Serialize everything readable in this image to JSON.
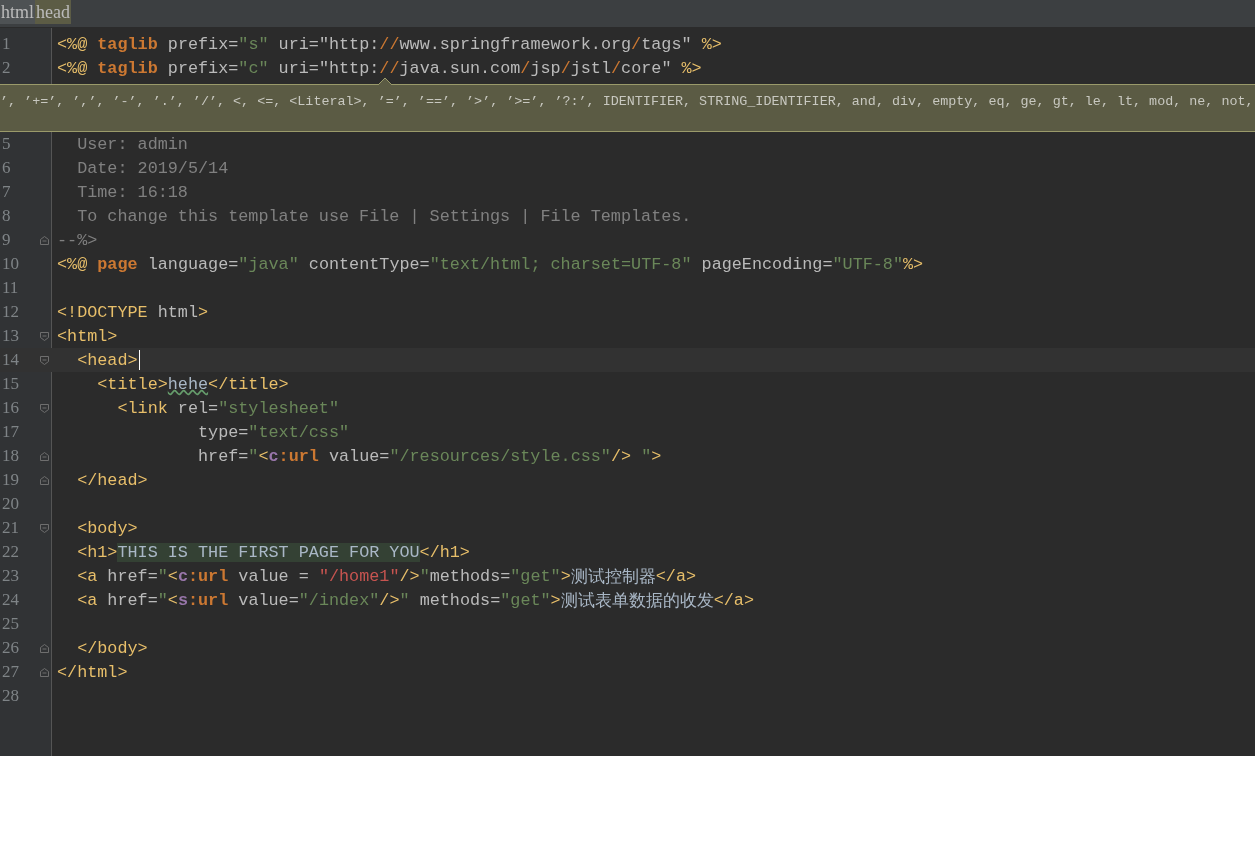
{
  "breadcrumb": [
    {
      "label": "html",
      "selected": false
    },
    {
      "label": "head",
      "selected": true
    }
  ],
  "lines": [
    {
      "number": "1",
      "current": false,
      "tokens": [
        {
          "kind": "tag",
          "text": "<%@ "
        },
        {
          "kind": "kw",
          "text": "taglib"
        },
        {
          "kind": "attr",
          "text": " prefix="
        },
        {
          "kind": "str",
          "text": "\"s\""
        },
        {
          "kind": "attr",
          "text": " uri="
        },
        {
          "kind": "val",
          "text": "\"http:"
        },
        {
          "kind": "slash",
          "text": "//"
        },
        {
          "kind": "val",
          "text": "www.springframework.org"
        },
        {
          "kind": "slash",
          "text": "/"
        },
        {
          "kind": "val",
          "text": "tags\" "
        },
        {
          "kind": "tag",
          "text": "%>"
        }
      ]
    },
    {
      "number": "2",
      "current": false,
      "tokens": [
        {
          "kind": "tag",
          "text": "<%@ "
        },
        {
          "kind": "kw",
          "text": "taglib"
        },
        {
          "kind": "attr",
          "text": " prefix="
        },
        {
          "kind": "str",
          "text": "\"c\""
        },
        {
          "kind": "attr",
          "text": " uri="
        },
        {
          "kind": "val",
          "text": "\"http:"
        },
        {
          "kind": "slash",
          "text": "//"
        },
        {
          "kind": "val",
          "text": "java.sun.com"
        },
        {
          "kind": "slash",
          "text": "/"
        },
        {
          "kind": "val",
          "text": "jsp"
        },
        {
          "kind": "slash",
          "text": "/"
        },
        {
          "kind": "val",
          "text": "jstl"
        },
        {
          "kind": "slash",
          "text": "/"
        },
        {
          "kind": "val",
          "text": "core\" "
        },
        {
          "kind": "tag",
          "text": "%>"
        }
      ]
    },
    {
      "kind": "tooltip",
      "text": "’, ’+=’, ’,’, ’-’, ’.’, ’/’, <, <=, <Literal>, ’=’, ’==’, ’>’, ’>=’, ’?:’, IDENTIFIER, STRING_IDENTIFIER, and, div, empty, eq, ge, gt, le, lt, mod, ne, not,"
    },
    {
      "number": "5",
      "current": false,
      "tokens": [
        {
          "kind": "comment",
          "text": "  User: admin"
        }
      ]
    },
    {
      "number": "6",
      "current": false,
      "tokens": [
        {
          "kind": "comment",
          "text": "  Date: 2019/5/14"
        }
      ]
    },
    {
      "number": "7",
      "current": false,
      "tokens": [
        {
          "kind": "comment",
          "text": "  Time: 16:18"
        }
      ]
    },
    {
      "number": "8",
      "current": false,
      "tokens": [
        {
          "kind": "comment",
          "text": "  To change this template use File | Settings | File Templates."
        }
      ]
    },
    {
      "number": "9",
      "current": false,
      "fold": {
        "kind": "end"
      },
      "tokens": [
        {
          "kind": "comment",
          "text": "--%>"
        }
      ]
    },
    {
      "number": "10",
      "current": false,
      "tokens": [
        {
          "kind": "tag",
          "text": "<%@ "
        },
        {
          "kind": "kw",
          "text": "page"
        },
        {
          "kind": "attr",
          "text": " language="
        },
        {
          "kind": "str",
          "text": "\"java\""
        },
        {
          "kind": "attr",
          "text": " contentType="
        },
        {
          "kind": "str",
          "text": "\"text/html; charset=UTF-8\""
        },
        {
          "kind": "attr",
          "text": " pageEncoding="
        },
        {
          "kind": "str",
          "text": "\"UTF-8\""
        },
        {
          "kind": "tag",
          "text": "%>"
        }
      ]
    },
    {
      "number": "11",
      "current": false
    },
    {
      "number": "12",
      "current": false,
      "tokens": [
        {
          "kind": "tag",
          "text": "<!DOCTYPE"
        },
        {
          "kind": "attr",
          "text": " html"
        },
        {
          "kind": "tag",
          "text": ">"
        }
      ]
    },
    {
      "number": "13",
      "current": false,
      "fold": {
        "kind": "start"
      },
      "tokens": [
        {
          "kind": "tag",
          "text": "<html>"
        }
      ]
    },
    {
      "number": "14",
      "current": true,
      "fold": {
        "kind": "start"
      },
      "tokens": [
        {
          "kind": "tag",
          "text": "  <head>"
        }
      ]
    },
    {
      "number": "15",
      "current": false,
      "tokens": [
        {
          "kind": "tag",
          "text": "    <title>"
        },
        {
          "kind": "typo",
          "text": "hehe"
        },
        {
          "kind": "tag",
          "text": "</title>"
        }
      ]
    },
    {
      "number": "16",
      "current": false,
      "fold": {
        "kind": "start"
      },
      "tokens": [
        {
          "kind": "tag",
          "text": "      <link"
        },
        {
          "kind": "attr",
          "text": " rel="
        },
        {
          "kind": "str",
          "text": "\"stylesheet\""
        }
      ]
    },
    {
      "number": "17",
      "current": false,
      "tokens": [
        {
          "kind": "attr",
          "text": "              type="
        },
        {
          "kind": "str",
          "text": "\"text/css\""
        }
      ]
    },
    {
      "number": "18",
      "current": false,
      "fold": {
        "kind": "end"
      },
      "tokens": [
        {
          "kind": "attr",
          "text": "              href="
        },
        {
          "kind": "str",
          "text": "\""
        },
        {
          "kind": "tag",
          "text": "<"
        },
        {
          "kind": "ns",
          "text": "c"
        },
        {
          "kind": "kw",
          "text": ":url"
        },
        {
          "kind": "attr",
          "text": " value="
        },
        {
          "kind": "str",
          "text": "\"/resources/style.css\""
        },
        {
          "kind": "tag",
          "text": "/>"
        },
        {
          "kind": "str",
          "text": " \""
        },
        {
          "kind": "tag",
          "text": ">"
        }
      ]
    },
    {
      "number": "19",
      "current": false,
      "fold": {
        "kind": "end"
      },
      "tokens": [
        {
          "kind": "tag",
          "text": "  </head>"
        }
      ]
    },
    {
      "number": "20",
      "current": false
    },
    {
      "number": "21",
      "current": false,
      "fold": {
        "kind": "start"
      },
      "tokens": [
        {
          "kind": "tag",
          "text": "  <body>"
        }
      ]
    },
    {
      "number": "22",
      "current": false,
      "tokens": [
        {
          "kind": "tag",
          "text": "  <h1>"
        },
        {
          "kind": "hl",
          "text": "THIS IS THE FIRST PAGE FOR YOU"
        },
        {
          "kind": "tag",
          "text": "</h1>"
        }
      ]
    },
    {
      "number": "23",
      "current": false,
      "tokens": [
        {
          "kind": "tag",
          "text": "  <a"
        },
        {
          "kind": "attr",
          "text": " href="
        },
        {
          "kind": "str",
          "text": "\""
        },
        {
          "kind": "tag",
          "text": "<"
        },
        {
          "kind": "ns",
          "text": "c"
        },
        {
          "kind": "kw",
          "text": ":url"
        },
        {
          "kind": "attr",
          "text": " value = "
        },
        {
          "kind": "red",
          "text": "\"/home1\""
        },
        {
          "kind": "tag",
          "text": "/>"
        },
        {
          "kind": "str",
          "text": "\""
        },
        {
          "kind": "attr",
          "text": "methods="
        },
        {
          "kind": "str",
          "text": "\"get\""
        },
        {
          "kind": "tag",
          "text": ">"
        },
        {
          "kind": "text",
          "text": "测试控制器"
        },
        {
          "kind": "tag",
          "text": "</a>"
        }
      ]
    },
    {
      "number": "24",
      "current": false,
      "tokens": [
        {
          "kind": "tag",
          "text": "  <a"
        },
        {
          "kind": "attr",
          "text": " href="
        },
        {
          "kind": "str",
          "text": "\""
        },
        {
          "kind": "tag",
          "text": "<"
        },
        {
          "kind": "ns",
          "text": "s"
        },
        {
          "kind": "kw",
          "text": ":url"
        },
        {
          "kind": "attr",
          "text": " value="
        },
        {
          "kind": "str",
          "text": "\"/index\""
        },
        {
          "kind": "tag",
          "text": "/>"
        },
        {
          "kind": "str",
          "text": "\" "
        },
        {
          "kind": "attr",
          "text": "methods="
        },
        {
          "kind": "str",
          "text": "\"get\""
        },
        {
          "kind": "tag",
          "text": ">"
        },
        {
          "kind": "text",
          "text": "测试表单数据的收发"
        },
        {
          "kind": "tag",
          "text": "</a>"
        }
      ]
    },
    {
      "number": "25",
      "current": false
    },
    {
      "number": "26",
      "current": false,
      "fold": {
        "kind": "end"
      },
      "tokens": [
        {
          "kind": "tag",
          "text": "  </body>"
        }
      ]
    },
    {
      "number": "27",
      "current": false,
      "fold": {
        "kind": "end"
      },
      "tokens": [
        {
          "kind": "tag",
          "text": "</html>"
        }
      ]
    },
    {
      "number": "28",
      "current": false
    }
  ]
}
